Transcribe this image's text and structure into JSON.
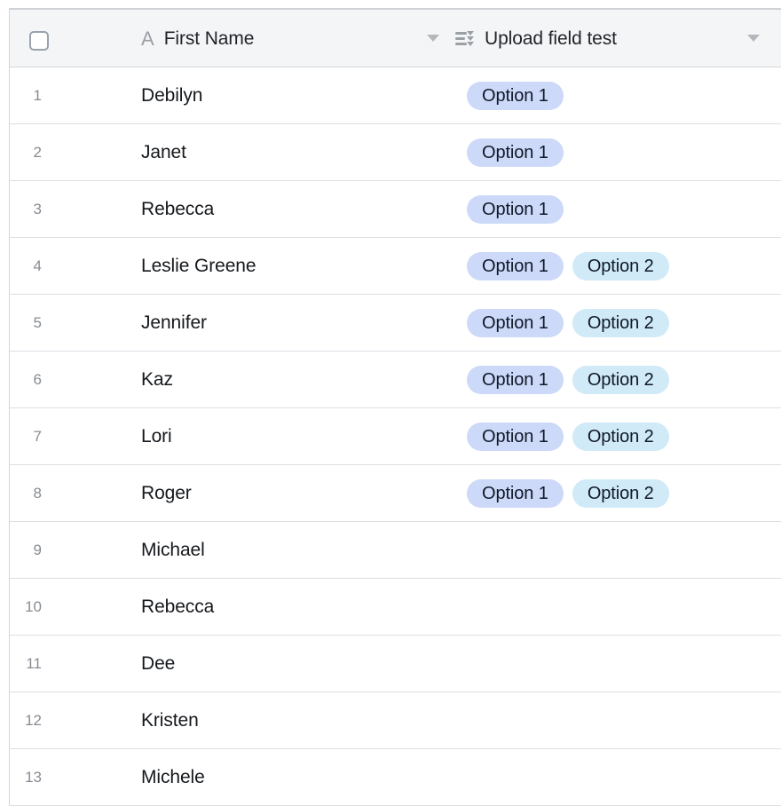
{
  "grid": {
    "select_all_checkbox": {
      "checked": false,
      "icon": "checkbox-icon"
    },
    "columns": [
      {
        "id": "row-number",
        "label": "",
        "icon": null,
        "has_dropdown": false
      },
      {
        "id": "first-name",
        "label": "First Name",
        "icon": "text-field-icon",
        "icon_glyph": "A",
        "has_dropdown": true,
        "dropdown_icon": "chevron-down-icon"
      },
      {
        "id": "upload-field-test",
        "label": "Upload field test",
        "icon": "multiselect-field-icon",
        "has_dropdown": true,
        "dropdown_icon": "chevron-down-icon"
      }
    ],
    "rows": [
      {
        "number": "1",
        "first_name": "Debilyn",
        "tags": [
          "Option 1"
        ]
      },
      {
        "number": "2",
        "first_name": "Janet",
        "tags": [
          "Option 1"
        ]
      },
      {
        "number": "3",
        "first_name": "Rebecca",
        "tags": [
          "Option 1"
        ]
      },
      {
        "number": "4",
        "first_name": "Leslie Greene",
        "tags": [
          "Option 1",
          "Option 2"
        ]
      },
      {
        "number": "5",
        "first_name": "Jennifer",
        "tags": [
          "Option 1",
          "Option 2"
        ]
      },
      {
        "number": "6",
        "first_name": "Kaz",
        "tags": [
          "Option 1",
          "Option 2"
        ]
      },
      {
        "number": "7",
        "first_name": "Lori",
        "tags": [
          "Option 1",
          "Option 2"
        ]
      },
      {
        "number": "8",
        "first_name": "Roger",
        "tags": [
          "Option 1",
          "Option 2"
        ]
      },
      {
        "number": "9",
        "first_name": "Michael",
        "tags": []
      },
      {
        "number": "10",
        "first_name": "Rebecca",
        "tags": []
      },
      {
        "number": "11",
        "first_name": "Dee",
        "tags": []
      },
      {
        "number": "12",
        "first_name": "Kristen",
        "tags": []
      },
      {
        "number": "13",
        "first_name": "Michele",
        "tags": []
      }
    ]
  },
  "tag_colors": {
    "Option 1": "#ccd9f8",
    "Option 2": "#d0eaf7"
  },
  "theme": {
    "header_background": "#f4f5f6",
    "row_background": "#ffffff",
    "border": "#d2d5d9",
    "row_divider": "#dcdfe3",
    "text_primary": "#15181c",
    "text_muted": "#878c93",
    "icon_color": "#9aa0a6"
  }
}
